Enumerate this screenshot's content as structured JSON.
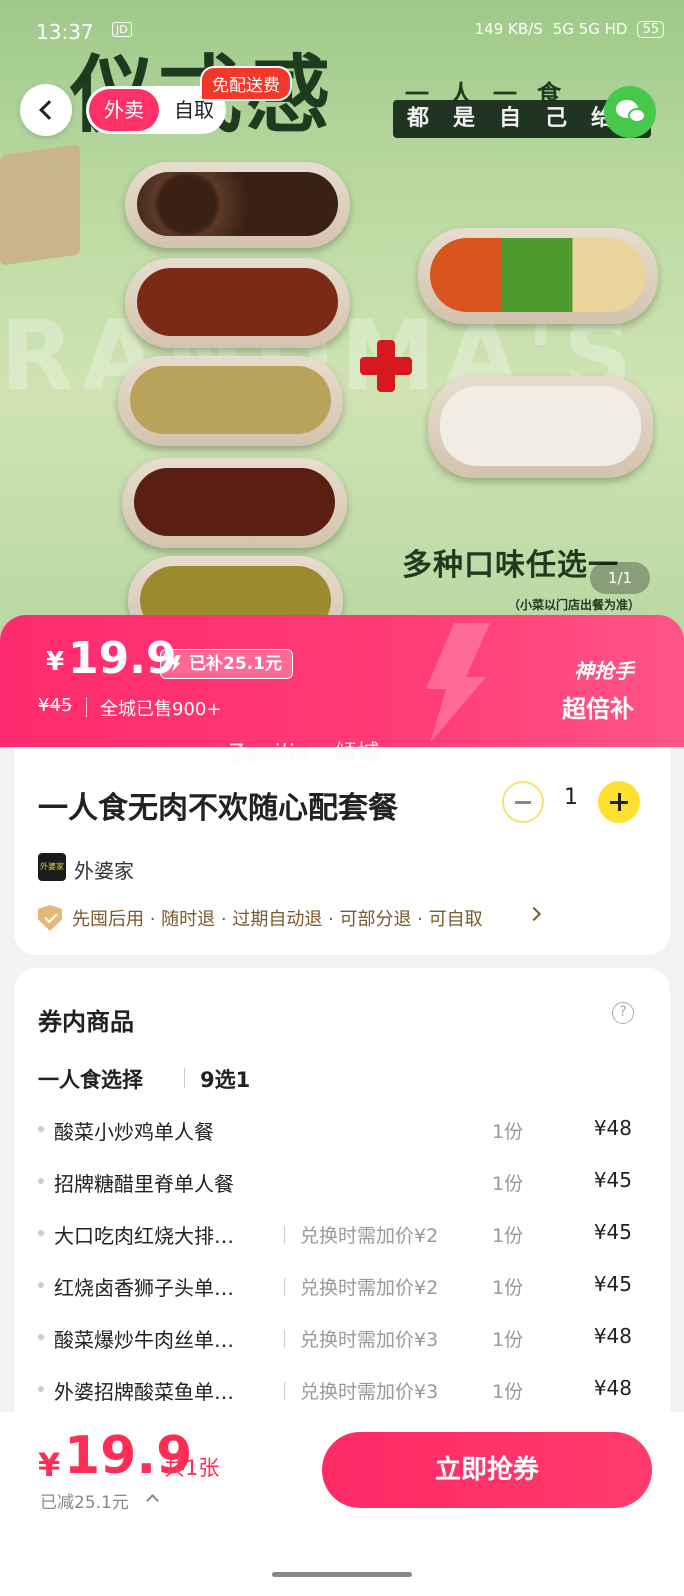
{
  "status_bar": {
    "time": "13:37",
    "carrier_badge": "JD",
    "net_speed": "149 KB/S",
    "network": "5G 5G HD",
    "battery": "55"
  },
  "nav": {
    "tab_delivery": "外卖",
    "tab_pickup": "自取",
    "free_delivery_badge": "免配送费"
  },
  "hero": {
    "headline": "仪式感",
    "tagline_1": "一人一食",
    "tagline_2": "都是自己给",
    "bg_text": "RANDMA'S HOM",
    "slogan": "多种口味任选一",
    "note": "（小菜以门店出餐为准）",
    "pager": "1/1"
  },
  "price_banner": {
    "currency": "¥",
    "price": "19.9",
    "subsidy": "已补25.1元",
    "original_price": "¥45",
    "sold": "全城已售900+",
    "promo_line_1": "神抢手",
    "promo_line_2": "超倍补"
  },
  "product": {
    "watermark": "Zanilia · 倾城",
    "title": "一人食无肉不欢随心配套餐",
    "quantity": "1",
    "store_logo_text": "外婆家",
    "store_name": "外婆家",
    "policies": "先囤后用 · 随时退 · 过期自动退 · 可部分退 · 可自取"
  },
  "items_section": {
    "heading": "券内商品",
    "help_icon_text": "?",
    "group_name": "一人食选择",
    "group_count": "9选1",
    "rows": [
      {
        "name": "酸菜小炒鸡单人餐",
        "extra": "",
        "qty": "1份",
        "price": "¥48"
      },
      {
        "name": "招牌糖醋里脊单人餐",
        "extra": "",
        "qty": "1份",
        "price": "¥45"
      },
      {
        "name": "大口吃肉红烧大排…",
        "extra": "兑换时需加价¥2",
        "qty": "1份",
        "price": "¥45"
      },
      {
        "name": "红烧卤香狮子头单…",
        "extra": "兑换时需加价¥2",
        "qty": "1份",
        "price": "¥45"
      },
      {
        "name": "酸菜爆炒牛肉丝单…",
        "extra": "兑换时需加价¥3",
        "qty": "1份",
        "price": "¥48"
      },
      {
        "name": "外婆招牌酸菜鱼单…",
        "extra": "兑换时需加价¥3",
        "qty": "1份",
        "price": "¥48"
      }
    ]
  },
  "bottom_bar": {
    "currency": "¥",
    "price": "19.9",
    "count": "共1张",
    "saved": "已减25.1元",
    "buy_label": "立即抢券"
  },
  "colors": {
    "accent": "#ff2d55",
    "banner": "#ff3c76",
    "plus_button": "#ffe02e",
    "policy_text": "#7c5a2c"
  },
  "icons": [
    "back-icon",
    "wechat-share-icon",
    "minus-icon",
    "plus-icon",
    "shield-check-icon",
    "chevron-right-icon",
    "help-icon",
    "chevron-up-icon"
  ]
}
